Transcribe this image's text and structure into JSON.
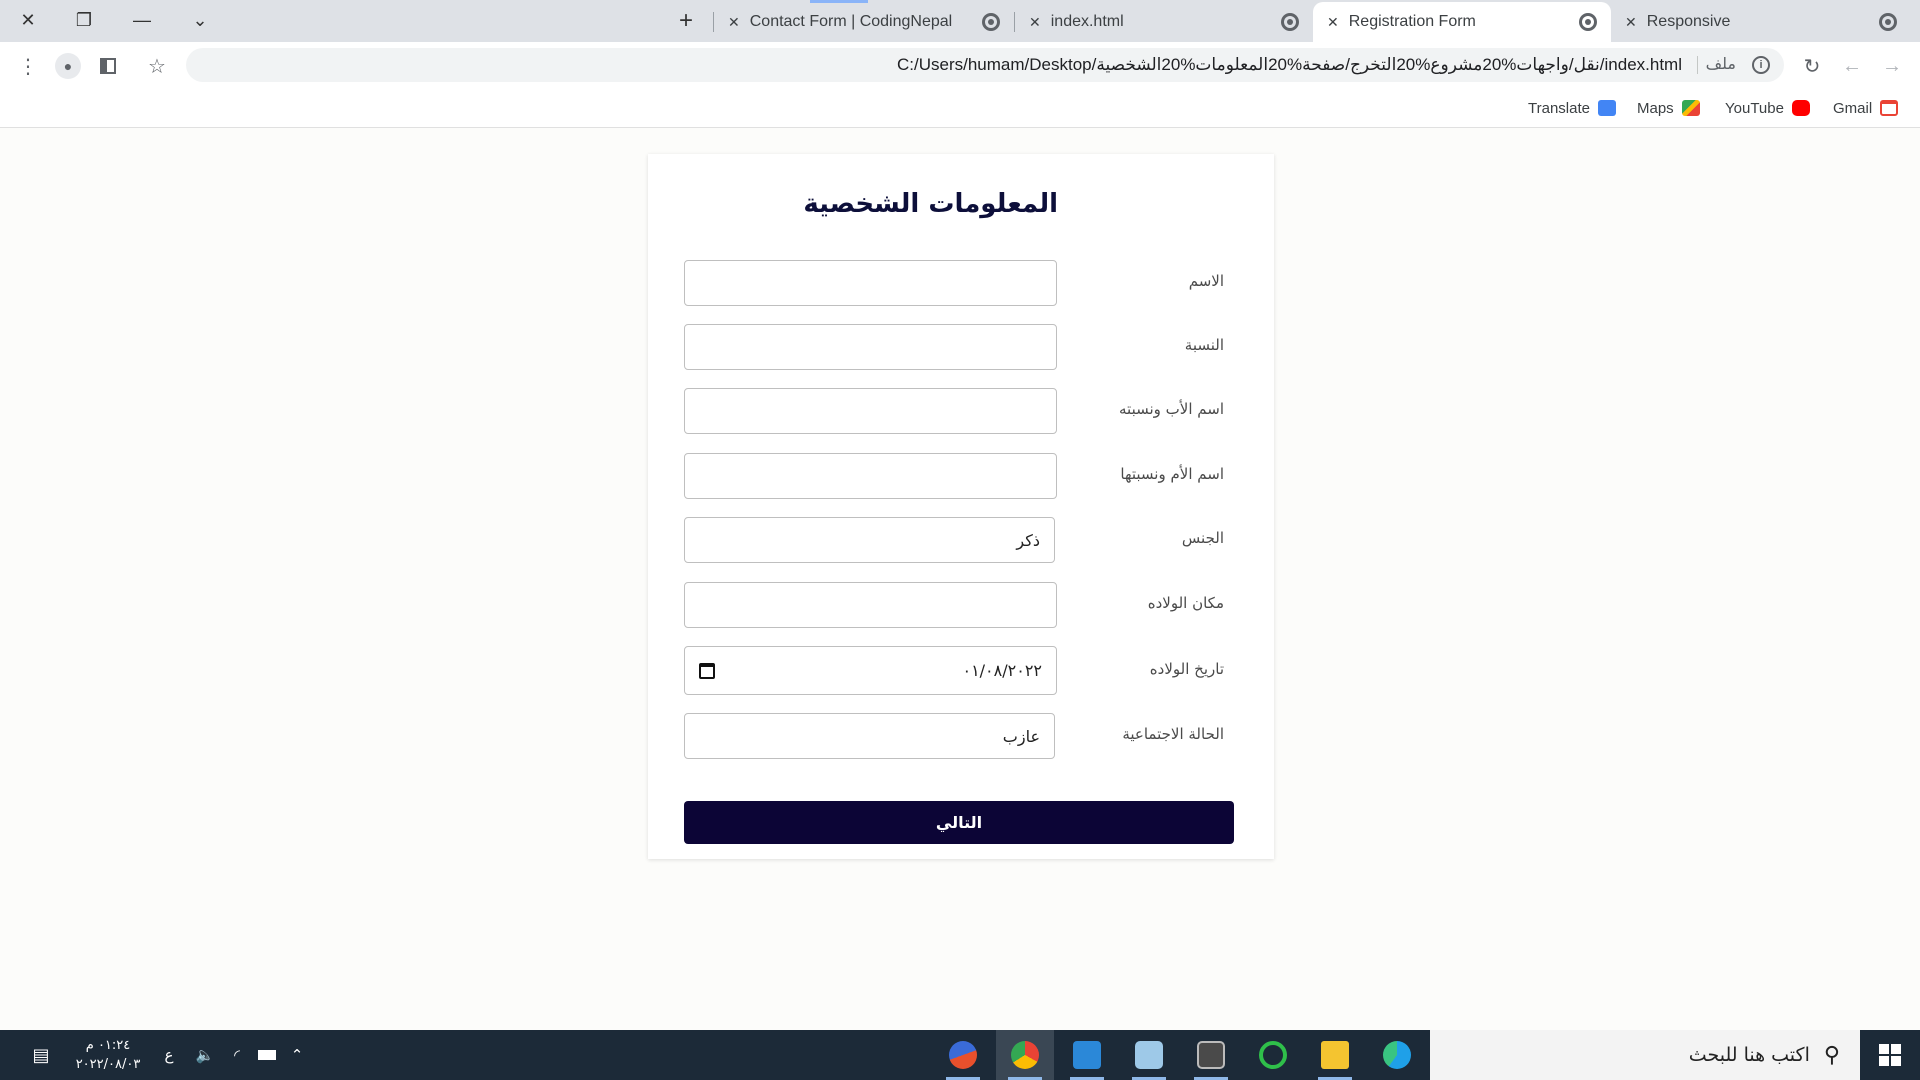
{
  "browser": {
    "window_controls": {
      "close": "✕",
      "restore": "❐",
      "minimize": "—",
      "tab_search": "⌄"
    },
    "new_tab": "+",
    "tabs": [
      {
        "title": "Responsive",
        "active": false
      },
      {
        "title": "Registration Form",
        "active": true
      },
      {
        "title": "index.html",
        "active": false
      },
      {
        "title": "Contact Form | CodingNepal",
        "active": false
      }
    ],
    "address": {
      "url": "C:/Users/humam/Desktop/نقل/واجهات%20مشروع%20التخرج/صفحة%20المعلومات%20الشخصية/index.html",
      "scheme_label": "ملف",
      "info_icon": "info-icon"
    },
    "bookmarks": [
      {
        "label": "Gmail",
        "icon": "gmail-icon",
        "color": "#ea4335"
      },
      {
        "label": "YouTube",
        "icon": "youtube-icon",
        "color": "#ff0000"
      },
      {
        "label": "Maps",
        "icon": "maps-icon",
        "color": "#34a853"
      },
      {
        "label": "Translate",
        "icon": "translate-icon",
        "color": "#4285f4"
      }
    ]
  },
  "form": {
    "title": "المعلومات الشخصية",
    "fields": {
      "first_name": {
        "label": "الاسم",
        "value": ""
      },
      "family_name": {
        "label": "النسبة",
        "value": ""
      },
      "father_name": {
        "label": "اسم الأب ونسبته",
        "value": ""
      },
      "mother_name": {
        "label": "اسم الأم ونسبتها",
        "value": ""
      },
      "gender": {
        "label": "الجنس",
        "value": "ذكر"
      },
      "birth_place": {
        "label": "مكان الولاده",
        "value": ""
      },
      "birth_date": {
        "label": "تاريخ الولاده",
        "value": "٠١/٠٨/٢٠٢٢"
      },
      "marital_status": {
        "label": "الحالة الاجتماعية",
        "value": "عازب"
      }
    },
    "submit_label": "التالي"
  },
  "taskbar": {
    "search_placeholder": "اكتب هنا للبحث",
    "time": "٠١:٢٤ م",
    "date": "٢٠٢٢/٠٨/٠٣",
    "language": "ع",
    "apps": [
      "paint-tool-icon",
      "chrome-icon",
      "vscode-icon",
      "notepad-icon",
      "terminal-icon",
      "circle-app-icon",
      "file-explorer-icon",
      "edge-icon"
    ]
  },
  "colors": {
    "form_title": "#0d0f3a",
    "submit_bg": "#0c0536",
    "taskbar_bg": "#1c2a38"
  }
}
